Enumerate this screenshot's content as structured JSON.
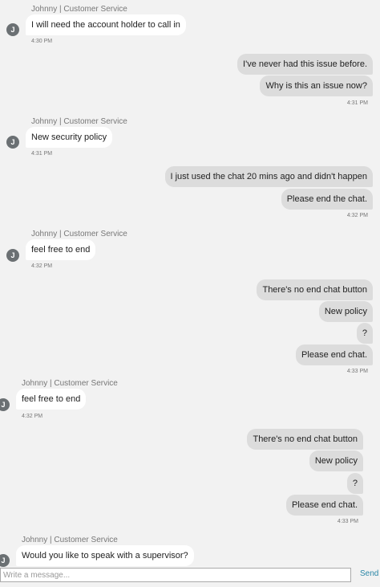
{
  "agent_label": "Johnny | Customer Service",
  "avatar_initial": "J",
  "messages": {
    "m1": "I will need the account holder to call in",
    "t1": "4:30 PM",
    "m2": "I've never had this issue before.",
    "m3": "Why is this an issue now?",
    "t2": "4:31 PM",
    "m4": "New security policy",
    "t3": "4:31 PM",
    "m5": "I just used the chat 20 mins ago and didn't happen",
    "m6": "Please end the chat.",
    "t4": "4:32 PM",
    "m7": "feel free to end",
    "t5": "4:32 PM",
    "m8": "There's no end chat button",
    "m9": "New policy",
    "m10": "?",
    "m11": "Please end chat.",
    "t6": "4:33 PM",
    "m12": "feel free to end",
    "t7": "4:32 PM",
    "m13": "There's no end chat button",
    "m14": "New policy",
    "m15": "?",
    "m16": "Please end chat.",
    "t8": "4:33 PM",
    "m17": "Would you like to speak with a supervisor?"
  },
  "composer": {
    "placeholder": "Write a message...",
    "send_label": "Send"
  }
}
